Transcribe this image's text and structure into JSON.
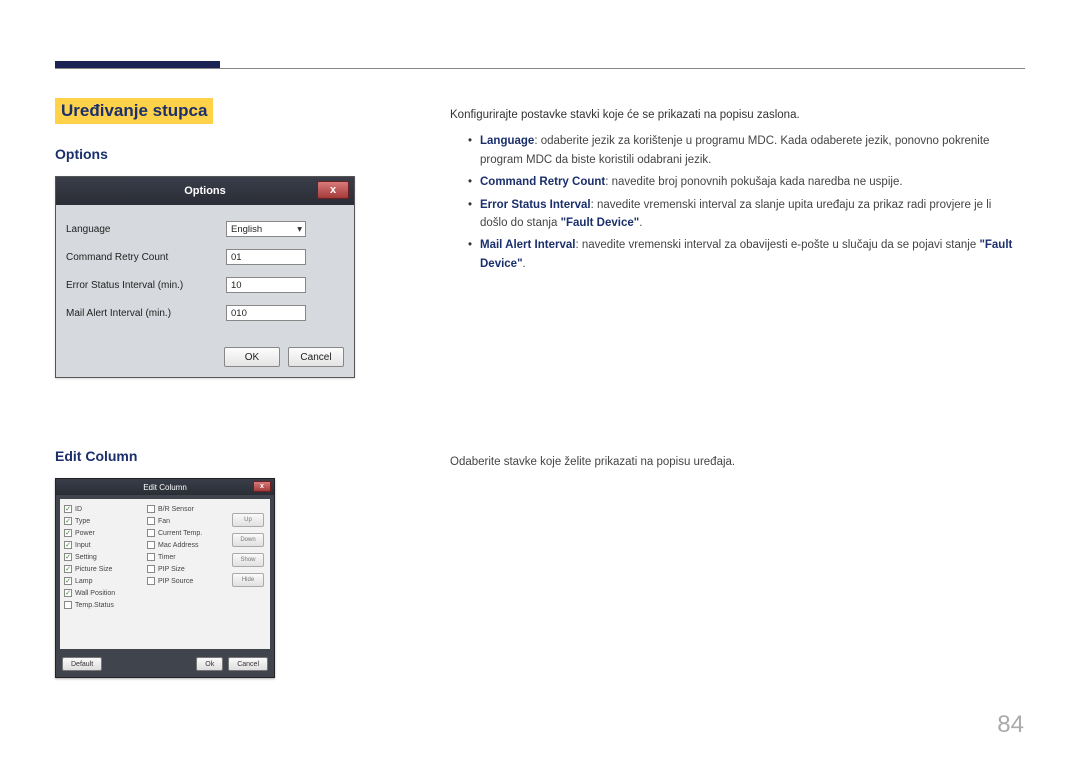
{
  "section_title": "Uređivanje stupca",
  "options": {
    "heading": "Options",
    "dialog_title": "Options",
    "close": "x",
    "rows": {
      "language_label": "Language",
      "language_value": "English",
      "retry_label": "Command Retry Count",
      "retry_value": "01",
      "error_label": "Error Status Interval (min.)",
      "error_value": "10",
      "mail_label": "Mail Alert Interval (min.)",
      "mail_value": "010"
    },
    "ok": "OK",
    "cancel": "Cancel"
  },
  "edit_column": {
    "heading": "Edit Column",
    "dialog_title": "Edit Column",
    "close": "x",
    "left_items": [
      {
        "label": "ID",
        "checked": true
      },
      {
        "label": "Type",
        "checked": true
      },
      {
        "label": "Power",
        "checked": true
      },
      {
        "label": "Input",
        "checked": true
      },
      {
        "label": "Setting",
        "checked": true
      },
      {
        "label": "Picture Size",
        "checked": true
      },
      {
        "label": "Lamp",
        "checked": true
      },
      {
        "label": "Wall Position",
        "checked": true
      },
      {
        "label": "Temp.Status",
        "checked": false
      }
    ],
    "right_items": [
      {
        "label": "B/R Sensor",
        "checked": false
      },
      {
        "label": "Fan",
        "checked": false
      },
      {
        "label": "Current Temp.",
        "checked": false
      },
      {
        "label": "Mac Address",
        "checked": false
      },
      {
        "label": "Timer",
        "checked": false
      },
      {
        "label": "PIP Size",
        "checked": false
      },
      {
        "label": "PIP Source",
        "checked": false
      }
    ],
    "side_buttons": [
      "Up",
      "Down",
      "Show",
      "Hide"
    ],
    "default": "Default",
    "ok": "Ok",
    "cancel": "Cancel"
  },
  "text": {
    "intro": "Konfigurirajte postavke stavki koje će se prikazati na popisu zaslona.",
    "lang_bold": "Language",
    "lang_rest": ": odaberite jezik za korištenje u programu MDC. Kada odaberete jezik, ponovno pokrenite program MDC da biste koristili odabrani jezik.",
    "retry_bold": "Command Retry Count",
    "retry_rest": ": navedite broj ponovnih pokušaja kada naredba ne uspije.",
    "error_bold": "Error Status Interval",
    "error_rest": ": navedite vremenski interval za slanje upita uređaju za prikaz radi provjere je li došlo do stanja ",
    "fault1": "\"Fault Device\"",
    "mail_bold": "Mail Alert Interval",
    "mail_rest": ": navedite vremenski interval za obavijesti e-pošte u slučaju da se pojavi stanje ",
    "fault2": "\"Fault Device\"",
    "edit_desc": "Odaberite stavke koje želite prikazati na popisu uređaja."
  },
  "page_number": "84"
}
